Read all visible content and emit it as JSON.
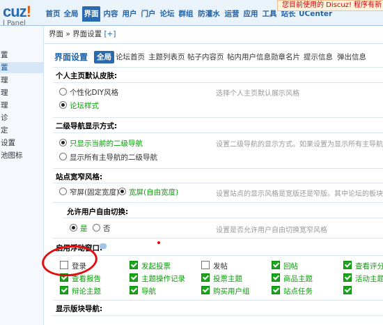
{
  "header": {
    "logo_text": "cuz",
    "logo_excl": "!",
    "logo_sub": "l Panel",
    "notice": "您目前使用的 Discuz! 程序有新",
    "nav_tabs": [
      "首页",
      "全局",
      "界面",
      "内容",
      "用户",
      "门户",
      "论坛",
      "群组",
      "防灌水",
      "运营",
      "应用",
      "工具",
      "站长",
      "UCenter"
    ],
    "active_tab": "界面"
  },
  "sidebar": {
    "items": [
      "置",
      "置",
      "理",
      "理",
      "理",
      "诊",
      "定",
      "设置",
      "池图标"
    ],
    "active_index": 1
  },
  "breadcrumb": {
    "text": "界面 » 界面设置",
    "plus": "[+]"
  },
  "subtabs": {
    "title": "界面设置",
    "items": [
      "全局",
      "论坛首页",
      "主题列表页",
      "帖子内容页",
      "帖内用户信息",
      "勋章名片",
      "提示信息",
      "弹出信息"
    ],
    "active": "全局"
  },
  "sections": {
    "skin": {
      "title": "个人主页默认皮肤:",
      "options": [
        "个性化DIY风格",
        "论坛样式"
      ],
      "selected_index": 1,
      "hint": "选择个人主页默认展示风格"
    },
    "subnav": {
      "title": "二级导航显示方式:",
      "options": [
        "只显示当前的二级导航",
        "显示所有主导航的二级导航"
      ],
      "selected_index": 0,
      "hint": "设置二级导航的显示方式。如果设置为显示所有主导航的二级"
    },
    "width": {
      "title": "站点宽窄风格:",
      "options": [
        "窄屏(固定宽度)",
        "宽屏(自由宽度)"
      ],
      "selected_index": 1,
      "hint": "设置站点的显示风格是宽版还是窄版。其中论坛的板块中还可"
    },
    "switch": {
      "title": "允许用户自由切换:",
      "options": [
        "是",
        "否"
      ],
      "selected_index": 0,
      "hint": "设置是否允许用户自由切换宽窄风格"
    },
    "popup": {
      "title": "启用浮动窗口:",
      "items": [
        {
          "label": "登录",
          "checked": false
        },
        {
          "label": "发起投票",
          "checked": true
        },
        {
          "label": "发帖",
          "checked": false
        },
        {
          "label": "回帖",
          "checked": true
        },
        {
          "label": "查看评分",
          "checked": true
        },
        {
          "label": "查看报告",
          "checked": true
        },
        {
          "label": "主题操作记录",
          "checked": true
        },
        {
          "label": "投票主题",
          "checked": true
        },
        {
          "label": "商品主题",
          "checked": true
        },
        {
          "label": "活动主题",
          "checked": true
        },
        {
          "label": "辩论主题",
          "checked": true
        },
        {
          "label": "导航",
          "checked": true
        },
        {
          "label": "购买用户组",
          "checked": true
        },
        {
          "label": "站点任务",
          "checked": true
        },
        {
          "label": "",
          "checked": true
        }
      ]
    },
    "forumnav": {
      "title": "显示版块导航:"
    }
  },
  "colors": {
    "accent": "#2a6bb0",
    "green_text": "#0a9c0a",
    "annotation_red": "#e01010"
  }
}
